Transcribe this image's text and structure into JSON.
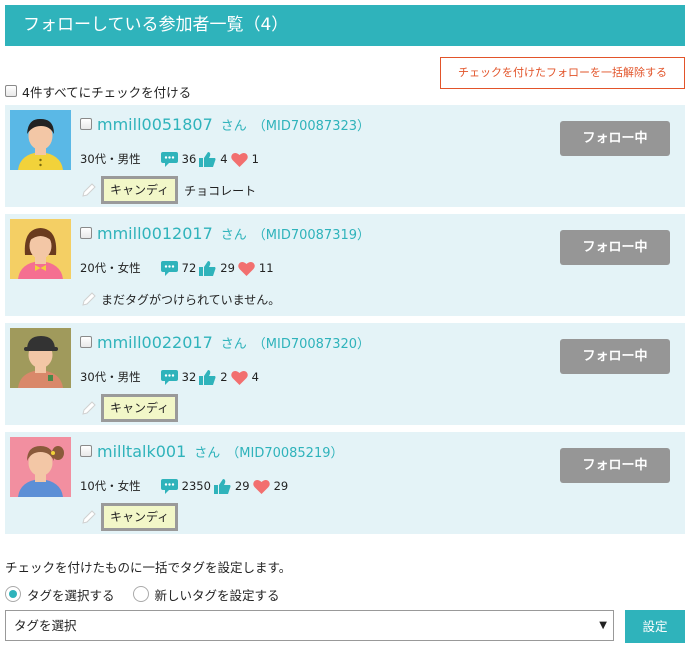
{
  "header": {
    "title": "フォローしている参加者一覧（4）"
  },
  "bulk_unfollow_label": "チェックを付けたフォローを一括解除する",
  "check_all_label": "4件すべてにチェックを付ける",
  "users": [
    {
      "username": "mmill0051807",
      "honorific": "さん",
      "mid": "（MID70087323）",
      "demographic": "30代・男性",
      "comments": "36",
      "likes": "4",
      "hearts": "1",
      "tag": "キャンディ",
      "tag_extra": "チョコレート",
      "follow_label": "フォロー中"
    },
    {
      "username": "mmill0012017",
      "honorific": "さん",
      "mid": "（MID70087319）",
      "demographic": "20代・女性",
      "comments": "72",
      "likes": "29",
      "hearts": "11",
      "no_tag_text": "まだタグがつけられていません。",
      "follow_label": "フォロー中"
    },
    {
      "username": "mmill0022017",
      "honorific": "さん",
      "mid": "（MID70087320）",
      "demographic": "30代・男性",
      "comments": "32",
      "likes": "2",
      "hearts": "4",
      "tag": "キャンディ",
      "follow_label": "フォロー中"
    },
    {
      "username": "milltalk001",
      "honorific": "さん",
      "mid": "（MID70085219）",
      "demographic": "10代・女性",
      "comments": "2350",
      "likes": "29",
      "hearts": "29",
      "tag": "キャンディ",
      "follow_label": "フォロー中"
    }
  ],
  "bulk_tag": {
    "description": "チェックを付けたものに一括でタグを設定します。",
    "radio_select": "タグを選択する",
    "radio_new": "新しいタグを設定する",
    "select_value": "タグを選択",
    "set_label": "設定"
  },
  "icons": {
    "comment": "comment-icon",
    "like": "thumbs-up-icon",
    "heart": "heart-icon",
    "tag_edit": "pencil-icon"
  },
  "colors": {
    "accent": "#2fb3bb",
    "danger": "#e2542a",
    "heart": "#f26f6f",
    "card_bg": "#e4f3f7",
    "follow_btn": "#969696"
  }
}
